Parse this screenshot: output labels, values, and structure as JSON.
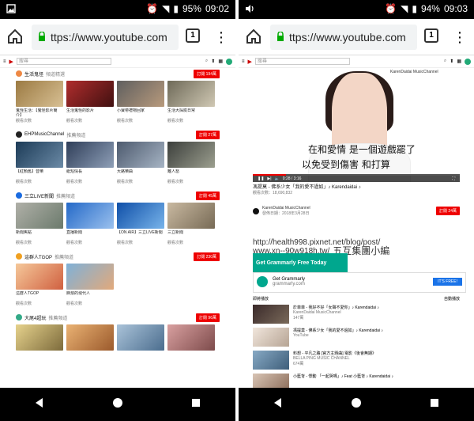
{
  "left": {
    "status": {
      "battery": "95%",
      "time": "09:02"
    },
    "browser": {
      "url": "ttps://www.youtube.com",
      "tab_count": "1"
    },
    "youtube": {
      "search_placeholder": "搜尋"
    },
    "sections": [
      {
        "name": "生活鬼怪",
        "subtitle": "頻道精選",
        "subscribe": "訂閱 194萬",
        "videos": [
          {
            "title": "鬼怪生活：【鬼怪影片簡介】",
            "channel": "生活鬼怪",
            "meta": "觀看次數"
          },
          {
            "title": "生活鬼怪的影片",
            "channel": "生活鬼怪",
            "meta": "觀看次數"
          },
          {
            "title": "小寶帶禮物回家",
            "channel": "生活鬼怪",
            "meta": "觀看次數"
          },
          {
            "title": "生活大探險日常",
            "channel": "生活鬼怪",
            "meta": "觀看次數"
          }
        ]
      },
      {
        "name": "EHPMusicChannel",
        "subtitle": "推薦頻道",
        "subscribe": "訂閱 27萬",
        "videos": [
          {
            "title": "【紅顏舊】音樂",
            "channel": "EHPMusicChannel",
            "meta": "觀看次數"
          },
          {
            "title": "紙短情長",
            "channel": "EHPMusicChannel",
            "meta": "觀看次數"
          },
          {
            "title": "大路樂曲",
            "channel": "EHPMusicChannel",
            "meta": "觀看次數"
          },
          {
            "title": "離人愁",
            "channel": "EHPMusicChannel",
            "meta": "觀看次數"
          }
        ]
      },
      {
        "name": "三立LIVE新聞",
        "subtitle": "推薦頻道",
        "subscribe": "訂閱 45萬",
        "videos": [
          {
            "title": "新聞焦點",
            "channel": "三立LIVE新聞",
            "meta": "觀看次數"
          },
          {
            "title": "直播新聞",
            "channel": "三立LIVE新聞",
            "meta": "觀看次數"
          },
          {
            "title": "【ON AIR】三立LIVE新聞",
            "channel": "三立LIVE新聞",
            "meta": "觀看次數"
          },
          {
            "title": "三立新聞",
            "channel": "三立LIVE新聞",
            "meta": "觀看次數"
          }
        ]
      },
      {
        "name": "這群人TGOP",
        "subtitle": "推薦頻道",
        "subscribe": "訂閱 230萬",
        "videos": [
          {
            "title": "這群人TGOP",
            "channel": "這群人TGOP",
            "meta": "觀看次數"
          },
          {
            "title": "麻煩的現代人",
            "channel": "這群人TGOP",
            "meta": "觀看次數"
          }
        ]
      },
      {
        "name": "大尾4超玩",
        "subtitle": "推薦頻道",
        "subscribe": "訂閱 96萬",
        "videos": []
      }
    ]
  },
  "right": {
    "status": {
      "battery": "94%",
      "time": "09:03"
    },
    "browser": {
      "url": "ttps://www.youtube.com",
      "tab_count": "1"
    },
    "video": {
      "watermark": "KarenDaidai MusicChannel",
      "subtitle_line1": "在和愛情 是一個遊戲罷了",
      "subtitle_line2": "以免受到傷害 和打算",
      "time": "0:28 / 3:16",
      "title": "馮提莫 - 佛系少女「我的愛不過如」♪ Karendaidai ♪",
      "views": "觀看次數：18,690,832",
      "channel_name": "KarenDaidai MusicChannel",
      "channel_date": "發佈日期：2018年3月28日",
      "subscribe": "訂閱 24萬",
      "watermark_text_1": "http://health998.pixnet.net/blog/post/",
      "watermark_text_2": "www.xn--90w918h.tw/",
      "watermark_brand": "五互集團小編",
      "ad_line1": "Get Grammarly Free Today",
      "ad_line2": "Get Grammarly",
      "ad_domain": "grammarly.com",
      "ad_cta": "IT'S FREE!",
      "related_title": "即將播放",
      "autoplay": "自動播放",
      "related": [
        {
          "title": "於菲菲 - 我好不好「女聲不愛你」♪ Karendaidai ♪",
          "channel": "KarenDaidai MusicChannel",
          "views": "147萬"
        },
        {
          "title": "馮提莫 - 佛系少女「我的愛不過如」♪ Karendaidai ♪",
          "channel": "YouTube",
          "views": ""
        },
        {
          "title": "料想 - 平凡之路 [官方主題曲] 電影《後會無期》",
          "channel": "BELLA PING MUSIC CHANNEL",
          "views": "674萬"
        },
        {
          "title": "小藍背 - 悸動 「一起哭嗎」♪ Feat 小藍背 ♪ Karendaidai ♪",
          "channel": "",
          "views": ""
        }
      ]
    }
  }
}
